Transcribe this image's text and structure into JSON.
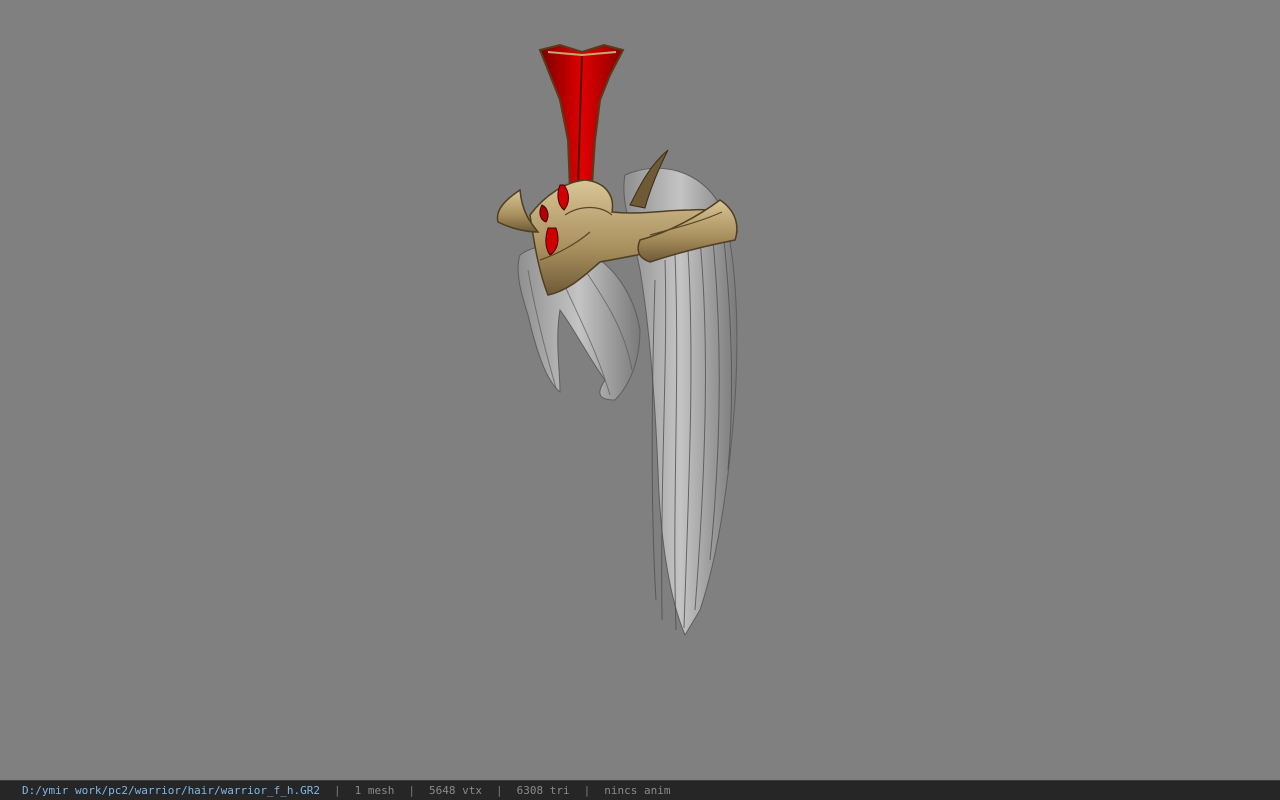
{
  "viewport": {
    "background_color": "#808080",
    "model_description_icon": "hair-helmet-model"
  },
  "statusbar": {
    "file_path": "D:/ymir work/pc2/warrior/hair/warrior_f_h.GR2",
    "separator": "|",
    "mesh_count": "1 mesh",
    "vertex_count": "5648 vtx",
    "triangle_count": "6308 tri",
    "anim_status": "nincs anim",
    "path_color": "#7fb6e8",
    "text_color": "#8a8a8a"
  }
}
